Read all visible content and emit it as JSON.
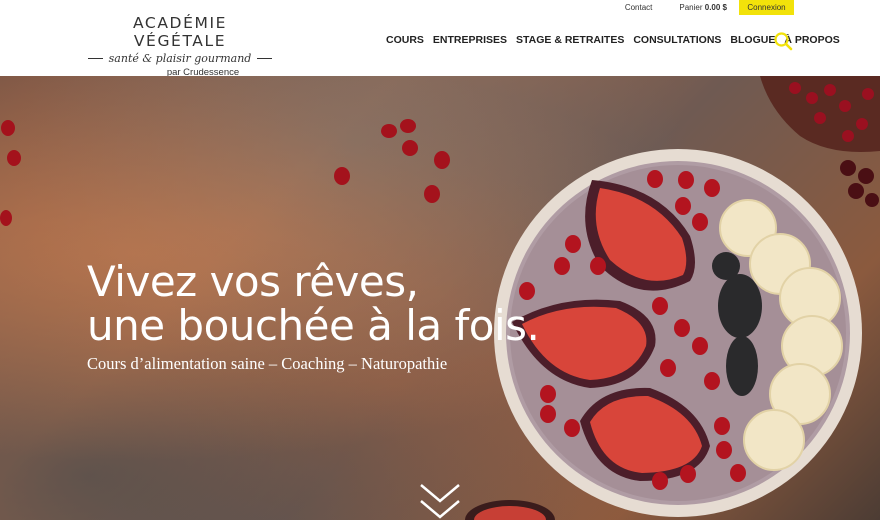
{
  "logo": {
    "title": "ACADÉMIE VÉGÉTALE",
    "tagline": "santé & plaisir gourmand",
    "by": "par Crudessence"
  },
  "utility": {
    "contact": "Contact",
    "panier_label": "Panier",
    "panier_amount": "0.00 $",
    "connexion": "Connexion"
  },
  "nav": {
    "items": [
      "COURS",
      "ENTREPRISES",
      "STAGE & RETRAITES",
      "CONSULTATIONS",
      "BLOGUE",
      "À PROPOS"
    ]
  },
  "hero": {
    "line1": "Vivez vos rêves,",
    "line2": "une bouchée à la fois.",
    "subtitle": "Cours d’alimentation saine – Coaching – Naturopathie"
  },
  "colors": {
    "accent": "#f2e20a",
    "text": "#222222"
  },
  "icons": {
    "search": "search-icon",
    "scroll": "chevron-down-icon"
  }
}
